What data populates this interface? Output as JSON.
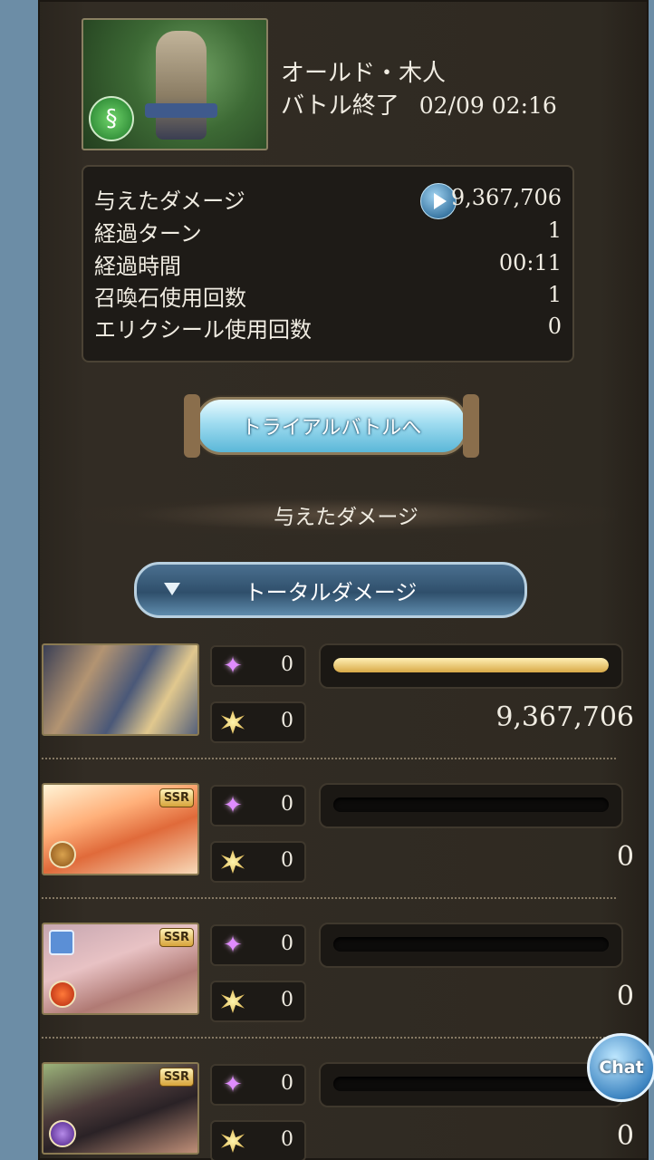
{
  "header": {
    "boss_name": "オールド・木人",
    "status": "バトル終了",
    "datetime": "02/09 02:16",
    "boss_element_icon": "wind-element-icon"
  },
  "stats": {
    "rows": [
      {
        "label": "与えたダメージ",
        "value": "9,367,706"
      },
      {
        "label": "経過ターン",
        "value": "1"
      },
      {
        "label": "経過時間",
        "value": "00:11"
      },
      {
        "label": "召喚石使用回数",
        "value": "1"
      },
      {
        "label": "エリクシール使用回数",
        "value": "0"
      }
    ]
  },
  "trial_button": {
    "label": "トライアルバトルへ"
  },
  "section_title": "与えたダメージ",
  "dropdown": {
    "selected": "トータルダメージ"
  },
  "characters": [
    {
      "element": "none",
      "ssr": "",
      "crit_count": "0",
      "ougi_count": "0",
      "damage": "9,367,706",
      "bar_fraction": 1.0
    },
    {
      "element": "earth",
      "ssr": "SSR",
      "crit_count": "0",
      "ougi_count": "0",
      "damage": "0",
      "bar_fraction": 0
    },
    {
      "element": "fire",
      "ssr": "SSR",
      "crit_count": "0",
      "ougi_count": "0",
      "damage": "0",
      "bar_fraction": 0
    },
    {
      "element": "dark",
      "ssr": "SSR",
      "crit_count": "0",
      "ougi_count": "0",
      "damage": "0",
      "bar_fraction": 0
    }
  ],
  "chat_button": {
    "label": "Chat"
  },
  "colors": {
    "bar_fill": "#d8a946",
    "accent_blue": "#5bb7d8",
    "background": "#2f2a22"
  }
}
